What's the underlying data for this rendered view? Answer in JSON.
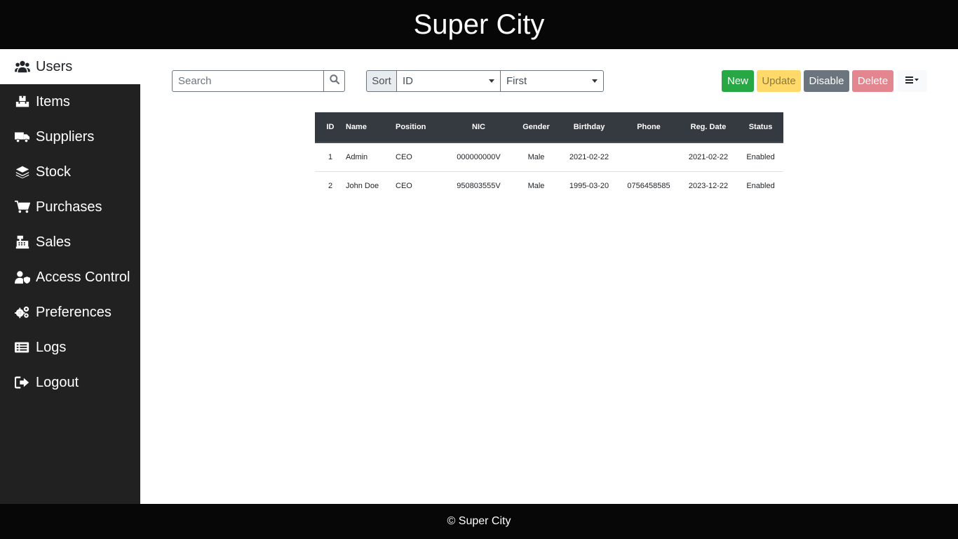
{
  "header": {
    "title": "Super City"
  },
  "sidebar": {
    "items": [
      {
        "label": "Users",
        "icon": "users-icon",
        "active": true
      },
      {
        "label": "Items",
        "icon": "boxes-icon"
      },
      {
        "label": "Suppliers",
        "icon": "truck-icon"
      },
      {
        "label": "Stock",
        "icon": "layers-icon"
      },
      {
        "label": "Purchases",
        "icon": "cart-icon"
      },
      {
        "label": "Sales",
        "icon": "cash-register-icon"
      },
      {
        "label": "Access Control",
        "icon": "user-shield-icon"
      },
      {
        "label": "Preferences",
        "icon": "cogs-icon"
      },
      {
        "label": "Logs",
        "icon": "list-icon"
      },
      {
        "label": "Logout",
        "icon": "sign-out-icon"
      }
    ]
  },
  "toolbar": {
    "search_placeholder": "Search",
    "sort_label": "Sort",
    "sort_field": "ID",
    "sort_order": "First",
    "new_label": "New",
    "update_label": "Update",
    "disable_label": "Disable",
    "delete_label": "Delete"
  },
  "table": {
    "columns": [
      "ID",
      "Name",
      "Position",
      "NIC",
      "Gender",
      "Birthday",
      "Phone",
      "Reg. Date",
      "Status"
    ],
    "rows": [
      [
        "1",
        "Admin",
        "CEO",
        "000000000V",
        "Male",
        "2021-02-22",
        "",
        "2021-02-22",
        "Enabled"
      ],
      [
        "2",
        "John Doe",
        "CEO",
        "950803555V",
        "Male",
        "1995-03-20",
        "0756458585",
        "2023-12-22",
        "Enabled"
      ]
    ]
  },
  "footer": {
    "text": "© Super City"
  },
  "colors": {
    "header_bg": "#070707",
    "sidebar_bg": "#212121",
    "table_header_bg": "#343a40",
    "new": "#28a745",
    "update": "#ffda6a",
    "disable": "#6c757d",
    "delete": "#e4868f"
  }
}
